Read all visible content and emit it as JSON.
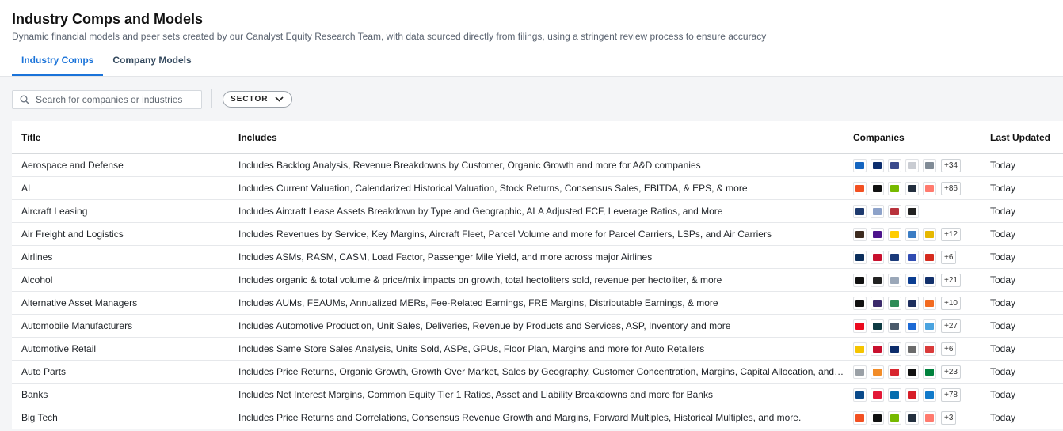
{
  "header": {
    "title": "Industry Comps and Models",
    "subtitle": "Dynamic financial models and peer sets created by our Canalyst Equity Research Team, with data sourced directly from filings, using a stringent review process to ensure accuracy"
  },
  "tabs": [
    {
      "label": "Industry Comps",
      "active": true
    },
    {
      "label": "Company Models",
      "active": false
    }
  ],
  "search": {
    "placeholder": "Search for companies or industries",
    "value": ""
  },
  "filters": {
    "sector_label": "SECTOR"
  },
  "colors": {
    "accent": "#1a73d9"
  },
  "table": {
    "columns": [
      "Title",
      "Includes",
      "Companies",
      "Last Updated"
    ],
    "rows": [
      {
        "title": "Aerospace and Defense",
        "includes": "Includes Backlog Analysis, Revenue Breakdowns by Customer, Organic Growth and more for A&D companies",
        "logos": [
          "#1565c0",
          "#0d2e6e",
          "#3a4a8c",
          "#c9ccd2",
          "#808b96"
        ],
        "more": "+34",
        "updated": "Today"
      },
      {
        "title": "AI",
        "includes": "Includes Current Valuation, Calendarized Historical Valuation, Stock Returns, Consensus Sales, EBITDA, & EPS, & more",
        "logos": [
          "#f25022",
          "#111111",
          "#76b900",
          "#232f3e",
          "#ff7a6e"
        ],
        "more": "+86",
        "updated": "Today"
      },
      {
        "title": "Aircraft Leasing",
        "includes": "Includes Aircraft Lease Assets Breakdown by Type and Geographic, ALA Adjusted FCF, Leverage Ratios, and More",
        "logos": [
          "#1e3a6e",
          "#8da2c9",
          "#b8323c",
          "#222222"
        ],
        "more": "",
        "updated": "Today"
      },
      {
        "title": "Air Freight and Logistics",
        "includes": "Includes Revenues by Service, Key Margins, Aircraft Fleet, Parcel Volume and more for Parcel Carriers, LSPs, and Air Carriers",
        "logos": [
          "#3d2b1f",
          "#4d148c",
          "#ffcc00",
          "#3b7dc4",
          "#e6b800"
        ],
        "more": "+12",
        "updated": "Today"
      },
      {
        "title": "Airlines",
        "includes": "Includes ASMs, RASM, CASM, Load Factor, Passenger Mile Yield, and more across major Airlines",
        "logos": [
          "#0b2e5c",
          "#c8102e",
          "#1a3a7a",
          "#304cb2",
          "#d52b1e"
        ],
        "more": "+6",
        "updated": "Today"
      },
      {
        "title": "Alcohol",
        "includes": "Includes organic & total volume & price/mix impacts on growth, total hectoliters sold, revenue per hectoliter, & more",
        "logos": [
          "#111111",
          "#222222",
          "#9aa7b8",
          "#0b3d91",
          "#12306b"
        ],
        "more": "+21",
        "updated": "Today"
      },
      {
        "title": "Alternative Asset Managers",
        "includes": "Includes AUMs, FEAUMs, Annualized MERs, Fee-Related Earnings, FRE Margins, Distributable Earnings, & more",
        "logos": [
          "#111111",
          "#3b2a6b",
          "#2e8b57",
          "#1e2f5e",
          "#f26b21"
        ],
        "more": "+10",
        "updated": "Today"
      },
      {
        "title": "Automobile Manufacturers",
        "includes": "Includes Automotive Production, Unit Sales, Deliveries, Revenue by Products and Services, ASP, Inventory and more",
        "logos": [
          "#eb0a1e",
          "#0e3b43",
          "#4a5a6a",
          "#1c69d4",
          "#4aa3df"
        ],
        "more": "+27",
        "updated": "Today"
      },
      {
        "title": "Automotive Retail",
        "includes": "Includes Same Store Sales Analysis, Units Sold, ASPs, GPUs, Floor Plan, Margins and more for Auto Retailers",
        "logos": [
          "#f5c400",
          "#c8102e",
          "#0d2d6c",
          "#6b6b6b",
          "#d93a3a"
        ],
        "more": "+6",
        "updated": "Today"
      },
      {
        "title": "Auto Parts",
        "includes": "Includes Price Returns, Organic Growth, Growth Over Market, Sales by Geography, Customer Concentration, Margins, Capital Allocation, and more",
        "logos": [
          "#9aa0a6",
          "#f28c28",
          "#d8262f",
          "#111111",
          "#00813c"
        ],
        "more": "+23",
        "updated": "Today"
      },
      {
        "title": "Banks",
        "includes": "Includes Net Interest Margins, Common Equity Tier 1 Ratios, Asset and Liability Breakdowns and more for Banks",
        "logos": [
          "#0a4a8a",
          "#e31837",
          "#056dae",
          "#d71e28",
          "#117aca"
        ],
        "more": "+78",
        "updated": "Today"
      },
      {
        "title": "Big Tech",
        "includes": "Includes Price Returns and Correlations, Consensus Revenue Growth and Margins, Forward Multiples, Historical Multiples, and more.",
        "logos": [
          "#f25022",
          "#111111",
          "#76b900",
          "#232f3e",
          "#ff7a6e"
        ],
        "more": "+3",
        "updated": "Today"
      }
    ]
  }
}
